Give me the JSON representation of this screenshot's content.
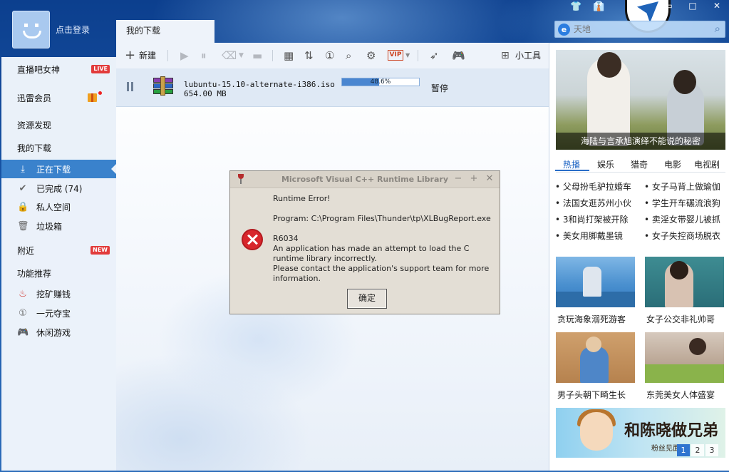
{
  "header": {
    "login": "点击登录",
    "tab": "我的下载",
    "search_placeholder": "天地"
  },
  "window": {
    "minimize": "▭",
    "maximize": "□",
    "close": "✕"
  },
  "sidebar": {
    "live": "直播吧女神",
    "live_badge": "LIVE",
    "vip": "迅雷会员",
    "discover": "资源发现",
    "my_downloads": "我的下载",
    "downloading": "正在下载",
    "completed": "已完成 (74)",
    "private": "私人空间",
    "trash": "垃圾箱",
    "nearby": "附近",
    "nearby_badge": "NEW",
    "recommend": "功能推荐",
    "mining": "挖矿赚钱",
    "treasure": "一元夺宝",
    "games": "休闲游戏"
  },
  "toolbar": {
    "new": "新建",
    "tools": "小工具"
  },
  "task": {
    "name": "lubuntu-15.10-alternate-i386.iso",
    "size": "654.00 MB",
    "progress_text": "48.6%",
    "progress": 0.486,
    "status": "暂停"
  },
  "dialog": {
    "title": "Microsoft Visual C++ Runtime Library",
    "line1": "Runtime Error!",
    "line2": "Program: C:\\Program Files\\Thunder\\tp\\XLBugReport.exe",
    "line3": "R6034",
    "line4": "An application has made an attempt to load the C",
    "line5": "runtime library incorrectly.",
    "line6": "Please contact the application's support team for more",
    "line7": "information.",
    "ok": "确定",
    "min": "−",
    "max": "+",
    "close": "✕"
  },
  "right": {
    "banner_caption": "海陆与言承旭演绎不能说的秘密",
    "tabs": [
      "热播",
      "娱乐",
      "猎奇",
      "电影",
      "电视剧"
    ],
    "news": [
      "父母扮毛驴拉婚车",
      "法国女逛苏州小伙",
      "3和尚打架被开除",
      "美女用脚戴墨镜",
      "女子马背上做瑜伽",
      "学生开车碾流浪狗",
      "卖淫女带婴儿被抓",
      "女子失控商场脱衣"
    ],
    "thumbs": [
      "贪玩海象溺死游客",
      "女子公交非礼帅哥",
      "男子头朝下畸生长",
      "东莞美女人体盛宴"
    ],
    "promo_title": "和陈晓做兄弟",
    "promo_sub": "粉丝见面",
    "pager": [
      "1",
      "2",
      "3"
    ]
  },
  "colors": {
    "accent": "#3a82cc",
    "error": "#d8262c",
    "link": "#2066c4"
  }
}
